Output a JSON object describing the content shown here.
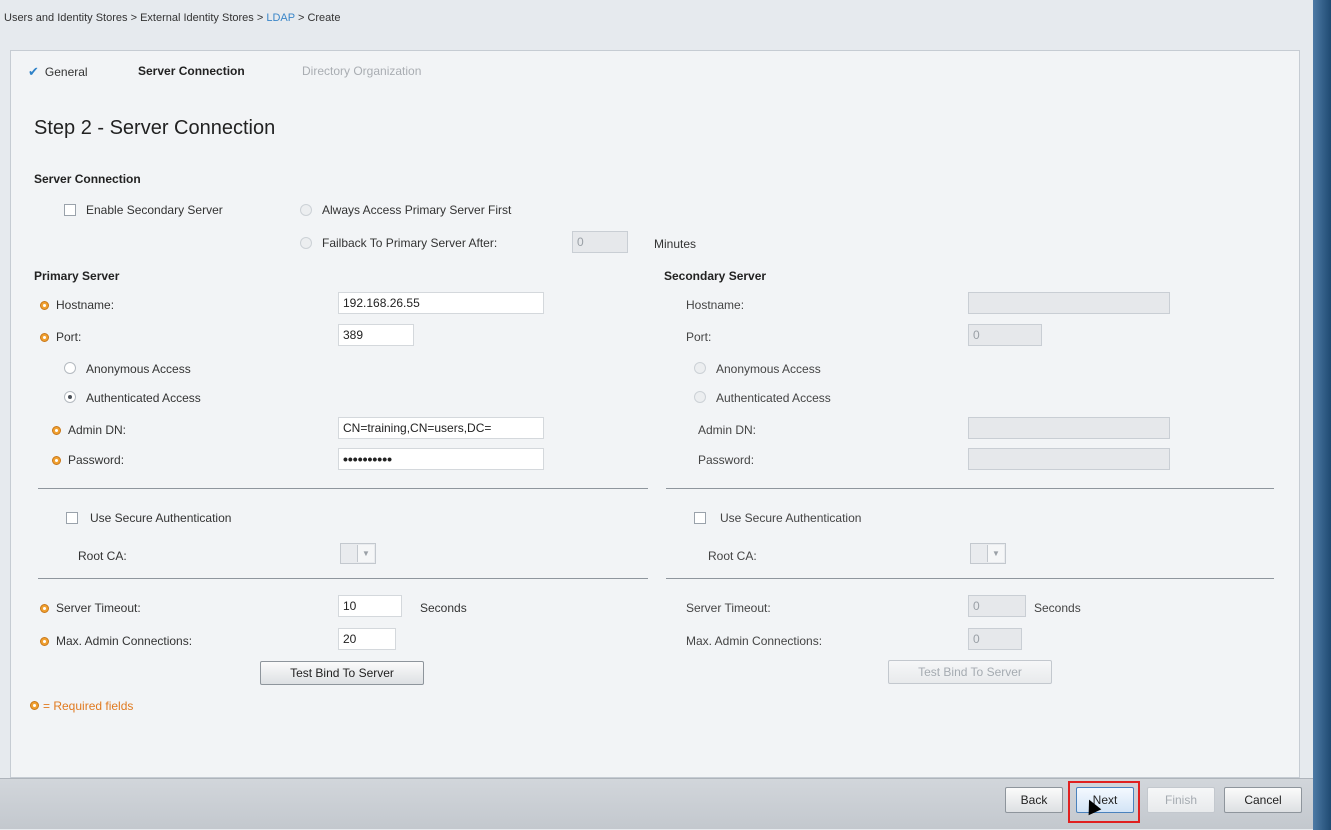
{
  "breadcrumb": {
    "part1": "Users and Identity Stores",
    "sep": " > ",
    "part2": "External Identity Stores",
    "part3": "LDAP",
    "part4": "Create"
  },
  "wizard": {
    "steps": [
      {
        "label": "General",
        "state": "done"
      },
      {
        "label": "Server Connection",
        "state": "current"
      },
      {
        "label": "Directory Organization",
        "state": "disabled"
      }
    ],
    "title": "Step 2 - Server Connection"
  },
  "server_connection": {
    "heading": "Server Connection",
    "enable_secondary_label": "Enable Secondary Server",
    "always_primary_label": "Always Access Primary Server First",
    "fallback_label": "Failback To Primary Server After:",
    "fallback_value": "0",
    "minutes_label": "Minutes"
  },
  "primary": {
    "heading": "Primary Server",
    "hostname_label": "Hostname:",
    "hostname_value": "192.168.26.55",
    "port_label": "Port:",
    "port_value": "389",
    "anonymous_label": "Anonymous Access",
    "authenticated_label": "Authenticated Access",
    "admin_dn_label": "Admin DN:",
    "admin_dn_value": "CN=training,CN=users,DC=",
    "password_label": "Password:",
    "password_value": "••••••••••",
    "secure_auth_label": "Use Secure Authentication",
    "root_ca_label": "Root CA:",
    "timeout_label": "Server Timeout:",
    "timeout_value": "10",
    "seconds_label": "Seconds",
    "max_conn_label": "Max. Admin Connections:",
    "max_conn_value": "20",
    "test_bind_label": "Test Bind To Server"
  },
  "secondary": {
    "heading": "Secondary Server",
    "hostname_label": "Hostname:",
    "hostname_value": "",
    "port_label": "Port:",
    "port_value": "0",
    "anonymous_label": "Anonymous Access",
    "authenticated_label": "Authenticated Access",
    "admin_dn_label": "Admin DN:",
    "password_label": "Password:",
    "secure_auth_label": "Use Secure Authentication",
    "root_ca_label": "Root CA:",
    "timeout_label": "Server Timeout:",
    "timeout_value": "0",
    "seconds_label": "Seconds",
    "max_conn_label": "Max. Admin Connections:",
    "max_conn_value": "0",
    "test_bind_label": "Test Bind To Server"
  },
  "required_note": "= Required fields",
  "footer": {
    "back": "Back",
    "next": "Next",
    "finish": "Finish",
    "cancel": "Cancel"
  },
  "colors": {
    "accent": "#3a86c8",
    "required": "#f0a030",
    "highlight": "#e02020"
  }
}
